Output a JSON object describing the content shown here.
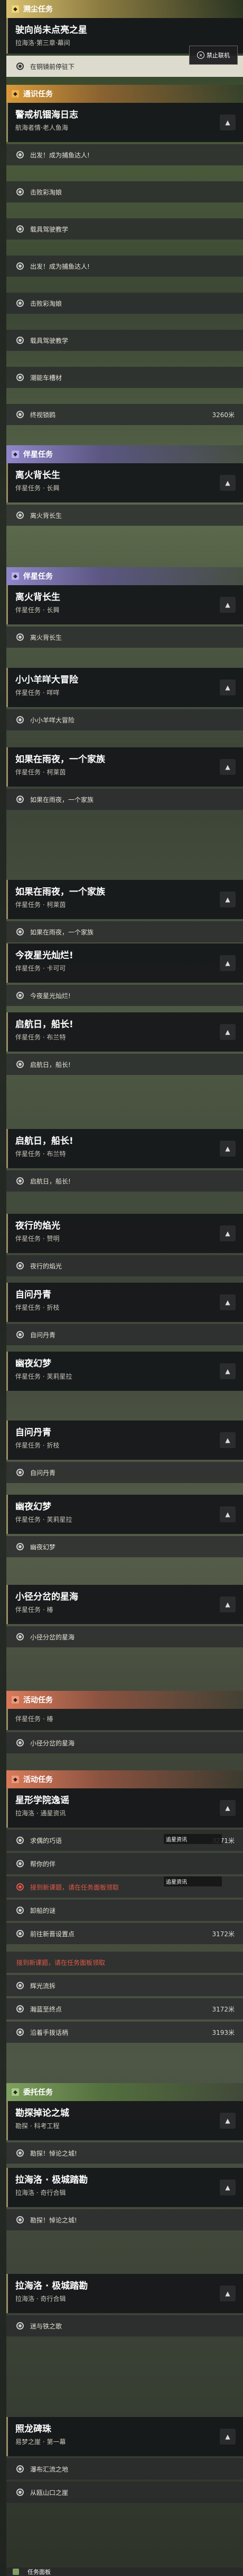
{
  "sections": {
    "main_task": "溯尘任务",
    "side_task": "通识任务",
    "star_task": "伴星任务",
    "event_task": "活动任务",
    "daily_task": "委托任务"
  },
  "main_quest": {
    "title": "驶向尚未点亮之星",
    "subtitle": "拉海洛·第三章·幕间",
    "step_current": "在铜镜前停驻下",
    "badge": "禁止联机"
  },
  "side_quest": {
    "title": "警戒机锢海日志",
    "subtitle": "航海者情·老人鱼海",
    "steps": [
      "出发！成为捕鱼达人!",
      "击败彩淘娘",
      "载具驾驶教学",
      "出发！成为捕鱼达人!",
      "击败彩淘娘",
      "载具驾驶教学",
      "潮能车槽材",
      "终视锁鸥"
    ],
    "last_dist": "3260米"
  },
  "star_quests": [
    {
      "title": "离火背长生",
      "subtitle": "伴星任务 · 长興",
      "step": "离火背长生"
    },
    {
      "title": "离火背长生",
      "subtitle": "伴星任务 · 长興",
      "step": "离火背长生"
    },
    {
      "title": "小小羊咩大冒险",
      "subtitle": "伴星任务 · 咩咩",
      "step": "小小羊咩大冒险"
    },
    {
      "title": "如果在雨夜，一个家族",
      "subtitle": "伴星任务 · 柯莱茵",
      "step": "如果在雨夜，一个家族"
    },
    {
      "title": "如果在雨夜，一个家族",
      "subtitle": "伴星任务 · 柯莱茵",
      "step": "如果在雨夜，一个家族"
    },
    {
      "title": "今夜星光灿烂!",
      "subtitle": "伴星任务 · 卡可可",
      "step": "今夜星光灿烂!"
    },
    {
      "title": "启航日，船长!",
      "subtitle": "伴星任务 · 布兰特",
      "step": "启航日，船长!"
    },
    {
      "title": "启航日，船长!",
      "subtitle": "伴星任务 · 布兰特",
      "step": "启航日，船长!"
    },
    {
      "title": "夜行的焰光",
      "subtitle": "伴星任务 · 赞明",
      "step": "夜行的焰光"
    },
    {
      "title": "自问丹青",
      "subtitle": "伴星任务 · 折枝",
      "step": "自问丹青"
    },
    {
      "title": "幽夜幻梦",
      "subtitle": "伴星任务 · 芙莉星拉",
      "step": "自问丹青"
    },
    {
      "title": "自问丹青",
      "subtitle": "伴星任务 · 折枝",
      "step": "自问丹青"
    },
    {
      "title": "幽夜幻梦",
      "subtitle": "伴星任务 · 芙莉星拉",
      "step": "幽夜幻梦"
    },
    {
      "title": "小径分岔的星海",
      "subtitle": "伴星任务 · 椿",
      "step": "小径分岔的星海"
    }
  ],
  "star_tail": {
    "subtitle": "伴星任务 · 椿",
    "step": "小径分岔的星海"
  },
  "event_quest": {
    "title": "星形学院逸谣",
    "subtitle": "拉海洛 · 通星资讯",
    "steps": [
      "求偶的巧语",
      "帮你的伴",
      "前往教导技术",
      "卸船的谜",
      "前往新晋设置点",
      "辉光流拆",
      "瀚蓝至终点",
      "沿着手拨话柄"
    ],
    "dists": [
      "3271米",
      "3172米",
      "3172米",
      "3193米"
    ],
    "notice": "接到新课题，请在任务面板领取",
    "red_step": "接到新课题，请在任务面板领取",
    "tip1": "追星资讯",
    "tip2": "追星资讯"
  },
  "daily_quests": [
    {
      "title": "勘探掉论之城",
      "subtitle": "勘探 · 科考工程",
      "step": "勘探！悼论之城!"
    },
    {
      "title": "拉海洛 · 极城踏勘",
      "subtitle": "拉海洛 · 奇行合辑",
      "step": "勘探！悼论之城!"
    },
    {
      "title": "拉海洛 · 极城踏勘",
      "subtitle": "拉海洛 · 奇行合辑",
      "step": "迷与铁之歌"
    },
    {
      "title": "照龙碑珠",
      "subtitle": "易梦之崖 · 第一幕",
      "step": "瀑布汇流之地"
    }
  ],
  "daily_extra": {
    "step": "从瓯山口之崖",
    "bottom": "任务面板"
  }
}
